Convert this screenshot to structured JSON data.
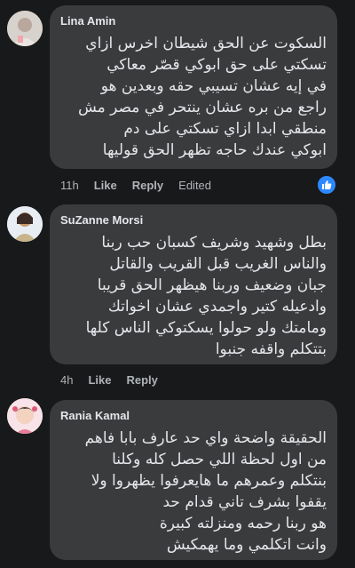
{
  "comments": [
    {
      "author": "Lina Amin",
      "text": "السكوت عن الحق شيطان اخرس ازاي\nتسكتي على حق ابوكي قصّر معاكي\nفي إيه عشان تسيبي حقه وبعدين هو\nراجع من بره عشان ينتحر في مصر مش\nمنطقي ابدا ازاي تسكتي على دم\nابوكي عندك حاجه تظهر الحق قوليها",
      "time": "11h",
      "like_label": "Like",
      "reply_label": "Reply",
      "edited_label": "Edited",
      "has_reaction": true
    },
    {
      "author": "SuZanne Morsi",
      "text": "بطل وشهيد وشريف كسبان حب ربنا\nوالناس الغريب قبل القريب والقاتل\nجبان وضعيف وربنا هيظهر الحق قريبا\nوادعيله كتير واجمدي عشان اخواتك\nومامتك ولو حولوا يسكتوكي الناس كلها\nبتتكلم واقفه جنبوا",
      "time": "4h",
      "like_label": "Like",
      "reply_label": "Reply"
    },
    {
      "author": "Rania Kamal",
      "text": "الحقيقة واضحة واي حد عارف بابا فاهم\nمن اول لحظة اللي حصل كله وكلنا\nبنتكلم وعمرهم ما هايعرفوا يظهروا ولا\nيقفوا بشرف تاني قدام حد\nهو ربنا رحمه ومنزلته كبيرة\nوانت اتكلمي وما يهمكيش"
    }
  ],
  "colors": {
    "background": "#18191a",
    "bubble": "#3a3b3c",
    "text": "#e4e6eb",
    "secondary": "#b0b3b8",
    "like_badge": "#2d88ff"
  },
  "icons": {
    "reaction": "thumbs-up-icon"
  }
}
